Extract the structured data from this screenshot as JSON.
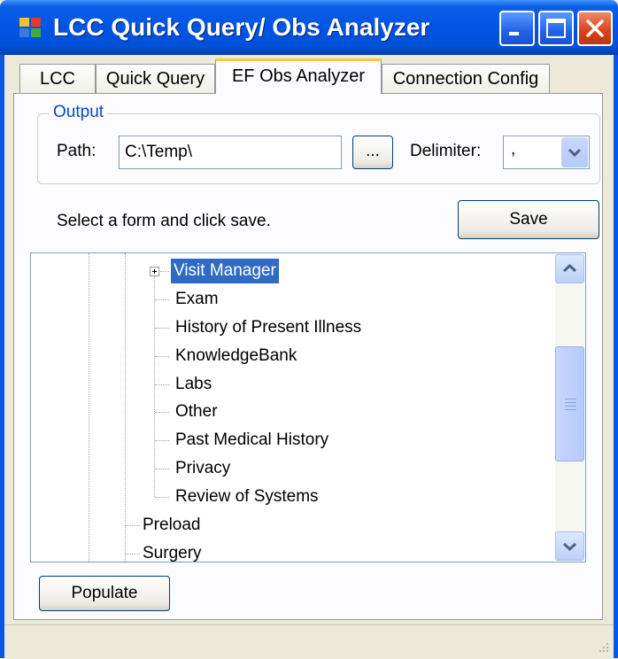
{
  "window": {
    "title": "LCC Quick Query/ Obs Analyzer",
    "icons": {
      "app": "app-icon",
      "minimize": "minimize-icon",
      "maximize": "maximize-icon",
      "close": "close-icon"
    }
  },
  "tabs": [
    {
      "label": "LCC",
      "active": false
    },
    {
      "label": "Quick Query",
      "active": false
    },
    {
      "label": "EF Obs Analyzer",
      "active": true
    },
    {
      "label": "Connection Config",
      "active": false
    }
  ],
  "output": {
    "legend": "Output",
    "path_label": "Path:",
    "path_value": "C:\\Temp\\",
    "browse_label": "...",
    "delimiter_label": "Delimiter:",
    "delimiter_value": ","
  },
  "instructions": "Select a form and click save.",
  "save_label": "Save",
  "tree": {
    "selected": "Visit Manager",
    "items": [
      "Visit Manager",
      "Exam",
      "History of Present Illness",
      "KnowledgeBank",
      "Labs",
      "Other",
      "Past Medical History",
      "Privacy",
      "Review of Systems",
      "Preload",
      "Surgery"
    ]
  },
  "populate_label": "Populate",
  "colors": {
    "titlebar": "#0054e3",
    "selection": "#316ac5",
    "group_legend": "#0046d5",
    "tab_highlight": "#ffc83c",
    "close_button": "#d94019"
  }
}
